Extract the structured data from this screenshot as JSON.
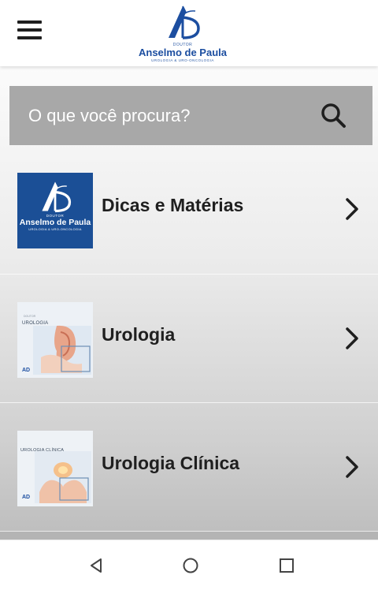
{
  "header": {
    "menu_icon": "hamburger-menu-icon",
    "logo": {
      "small_text": "DOUTOR",
      "name": "Anselmo de Paula",
      "tagline": "UROLOGIA & URO-ONCOLOGIA",
      "color": "#1c4ea0"
    }
  },
  "search": {
    "placeholder": "O que você procura?",
    "value": "",
    "icon": "search-icon",
    "background": "#a8a8a8"
  },
  "categories": [
    {
      "label": "Dicas e Matérias",
      "thumbnail": {
        "type": "brand-logo",
        "small_text": "DOUTOR",
        "name": "Anselmo de Paula",
        "tagline": "UROLOGIA & URO-ONCOLOGIA",
        "background": "#1b4f96"
      },
      "icon": "chevron-right-icon"
    },
    {
      "label": "Urologia",
      "thumbnail": {
        "type": "photo",
        "title": "UROLOGIA",
        "subtitle": "DOUTOR"
      },
      "icon": "chevron-right-icon"
    },
    {
      "label": "Urologia Clínica",
      "thumbnail": {
        "type": "photo",
        "title": "UROLOGIA CLÍNICA"
      },
      "icon": "chevron-right-icon"
    }
  ],
  "navigation": {
    "back_icon": "back-triangle-icon",
    "home_icon": "home-circle-icon",
    "recents_icon": "recents-square-icon"
  }
}
